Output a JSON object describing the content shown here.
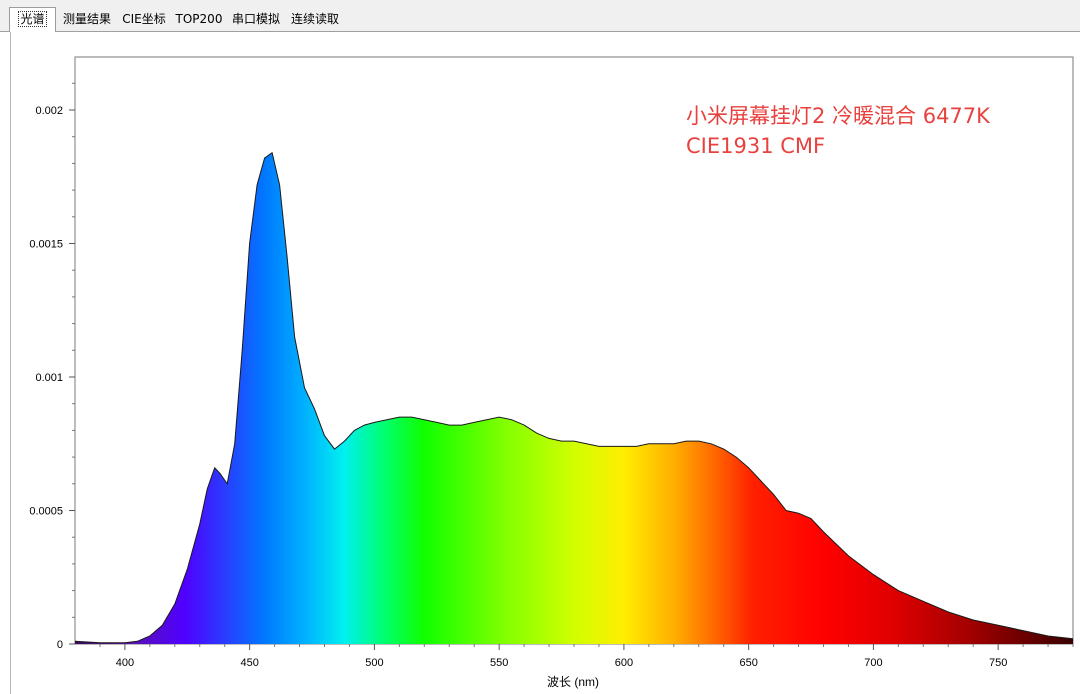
{
  "tabs": [
    {
      "label": "光谱",
      "active": true
    },
    {
      "label": "测量结果",
      "active": false
    },
    {
      "label": "CIE坐标",
      "active": false
    },
    {
      "label": "TOP200",
      "active": false
    },
    {
      "label": "串口模拟",
      "active": false
    },
    {
      "label": "连续读取",
      "active": false
    }
  ],
  "annotation": {
    "line1": "小米屏幕挂灯2 冷暖混合 6477K",
    "line2": "CIE1931 CMF",
    "color": "#e8423e"
  },
  "chart_data": {
    "type": "area",
    "xlabel": "波长 (nm)",
    "ylabel": "",
    "xlim": [
      380,
      780
    ],
    "ylim": [
      0,
      0.0023
    ],
    "x_ticks": [
      400,
      450,
      500,
      550,
      600,
      650,
      700,
      750
    ],
    "y_ticks": [
      0,
      0.0005,
      0.001,
      0.0015,
      0.002
    ],
    "y_tick_labels": [
      "0",
      "0.0005",
      "0.001",
      "0.0015",
      "0.002"
    ],
    "fill": "visible-spectrum gradient",
    "series": [
      {
        "x": [
          380,
          390,
          400,
          405,
          410,
          415,
          420,
          425,
          430,
          433,
          436,
          438,
          441,
          444,
          447,
          450,
          453,
          456,
          459,
          462,
          465,
          468,
          472,
          476,
          480,
          484,
          488,
          492,
          496,
          500,
          505,
          510,
          515,
          520,
          525,
          530,
          535,
          540,
          545,
          550,
          555,
          560,
          565,
          570,
          575,
          580,
          585,
          590,
          595,
          600,
          605,
          610,
          615,
          620,
          625,
          630,
          635,
          640,
          645,
          650,
          655,
          660,
          665,
          670,
          675,
          680,
          690,
          700,
          710,
          720,
          730,
          740,
          750,
          760,
          770,
          780
        ],
        "y": [
          1e-05,
          5e-06,
          5e-06,
          1e-05,
          3e-05,
          7e-05,
          0.00015,
          0.00028,
          0.00045,
          0.00058,
          0.00066,
          0.00064,
          0.0006,
          0.00075,
          0.0011,
          0.0015,
          0.00172,
          0.00182,
          0.00184,
          0.00172,
          0.00145,
          0.00115,
          0.00096,
          0.00088,
          0.00078,
          0.00073,
          0.00076,
          0.0008,
          0.00082,
          0.00083,
          0.00084,
          0.00085,
          0.00085,
          0.00084,
          0.00083,
          0.00082,
          0.00082,
          0.00083,
          0.00084,
          0.00085,
          0.00084,
          0.00082,
          0.00079,
          0.00077,
          0.00076,
          0.00076,
          0.00075,
          0.00074,
          0.00074,
          0.00074,
          0.00074,
          0.00075,
          0.00075,
          0.00075,
          0.00076,
          0.00076,
          0.00075,
          0.00073,
          0.0007,
          0.00066,
          0.00061,
          0.00056,
          0.0005,
          0.00049,
          0.00047,
          0.00042,
          0.00033,
          0.00026,
          0.0002,
          0.00016,
          0.00012,
          9e-05,
          7e-05,
          5e-05,
          3e-05,
          2e-05
        ]
      }
    ]
  }
}
